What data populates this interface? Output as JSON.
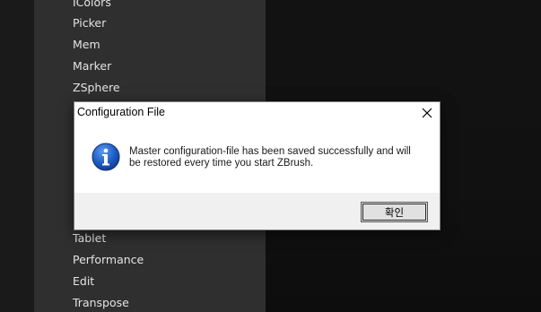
{
  "menu": {
    "items_top": [
      "IColors",
      "Picker",
      "Mem",
      "Marker",
      "ZSphere"
    ],
    "items_bottom": [
      "Tablet",
      "Performance",
      "Edit",
      "Transpose"
    ]
  },
  "dialog": {
    "title": "Configuration File",
    "close_icon": "close-icon",
    "icon": "info-icon",
    "message_line1": "Master configuration-file has been saved successfully and will",
    "message_line2": "be restored every time you start ZBrush.",
    "ok_label": "확인"
  },
  "colors": {
    "panel": "#2f2f2f",
    "background": "#0c0c0c",
    "info_icon_blue": "#1d5bc4"
  }
}
